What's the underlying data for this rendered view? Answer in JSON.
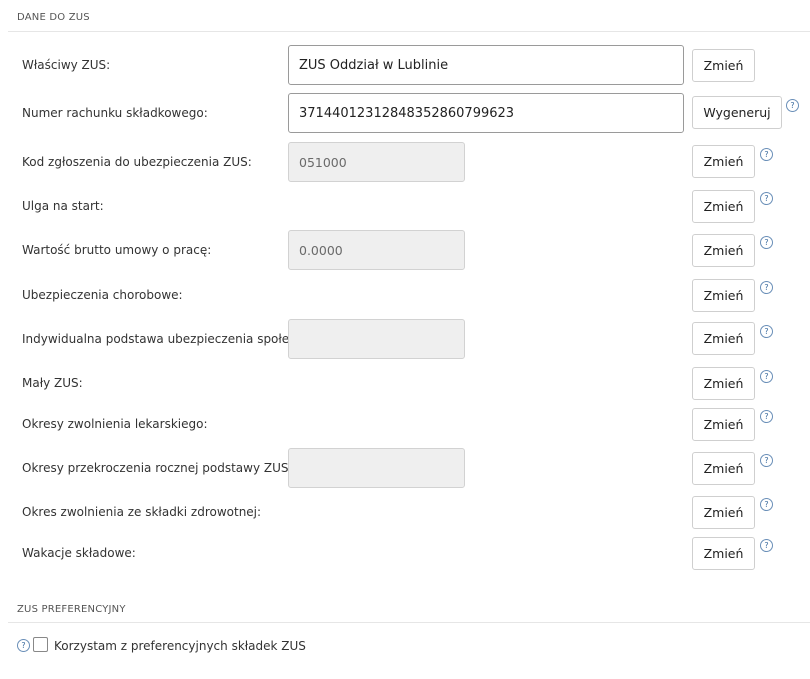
{
  "sections": {
    "zus_data_title": "DANE DO ZUS",
    "zus_pref_title": "ZUS PREFERENCYJNY"
  },
  "fields": {
    "owner": {
      "label": "Właściwy ZUS:",
      "value": "ZUS Oddział w Lublinie",
      "button": "Zmień"
    },
    "account": {
      "label": "Numer rachunku składkowego:",
      "value": "37144012312848352860799623",
      "button": "Wygeneruj"
    },
    "code": {
      "label": "Kod zgłoszenia do ubezpieczenia ZUS:",
      "value": "051000",
      "button": "Zmień"
    },
    "ulga": {
      "label": "Ulga na start:",
      "button": "Zmień"
    },
    "gross": {
      "label": "Wartość brutto umowy o pracę:",
      "value": "0.0000",
      "button": "Zmień"
    },
    "sick": {
      "label": "Ubezpieczenia chorobowe:",
      "button": "Zmień"
    },
    "base": {
      "label": "Indywidualna podstawa ubezpieczenia społecznego:",
      "value": "",
      "button": "Zmień"
    },
    "maly": {
      "label": "Mały ZUS:",
      "button": "Zmień"
    },
    "leave": {
      "label": "Okresy zwolnienia lekarskiego:",
      "button": "Zmień"
    },
    "exceed": {
      "label": "Okresy przekroczenia rocznej podstawy ZUS:",
      "value": "",
      "button": "Zmień"
    },
    "health": {
      "label": "Okres zwolnienia ze składki zdrowotnej:",
      "button": "Zmień"
    },
    "vacation": {
      "label": "Wakacje składowe:",
      "button": "Zmień"
    }
  },
  "help_glyph": "?",
  "preferential": {
    "checkbox_label": "Korzystam z preferencyjnych składek ZUS",
    "checked": false
  },
  "icons": {
    "help": "question-circle-icon"
  },
  "colors": {
    "help_accent": "#3a6a9e",
    "input_border": "#9a9a9a",
    "disabled_bg": "#efefef"
  }
}
